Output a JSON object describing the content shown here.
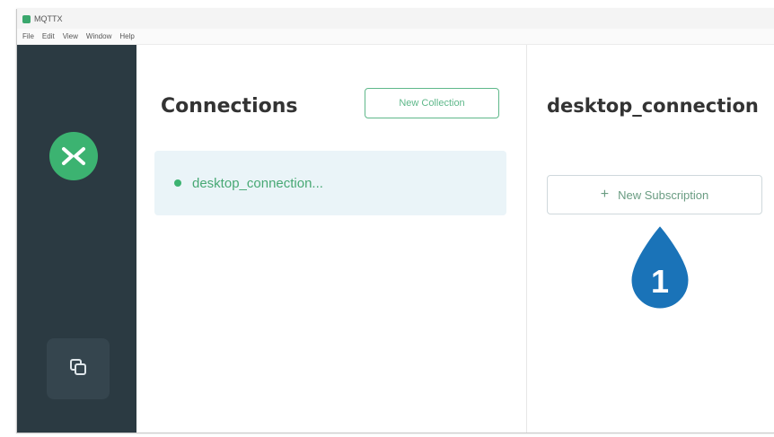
{
  "window": {
    "title": "MQTTX"
  },
  "menu": [
    "File",
    "Edit",
    "View",
    "Window",
    "Help"
  ],
  "sidebar": {
    "logo_icon": "mqttx-logo-icon",
    "button_icon": "copy-icon"
  },
  "connections": {
    "title": "Connections",
    "new_collection_label": "New Collection",
    "items": [
      {
        "label": "desktop_connection...",
        "status": "connected"
      }
    ]
  },
  "detail": {
    "title": "desktop_connection",
    "new_subscription_label": "New Subscription",
    "plus_glyph": "+"
  },
  "callout": {
    "number": "1"
  },
  "colors": {
    "sidebar": "#2b3a42",
    "accent": "#3cb371",
    "callout": "#1a73b8"
  }
}
